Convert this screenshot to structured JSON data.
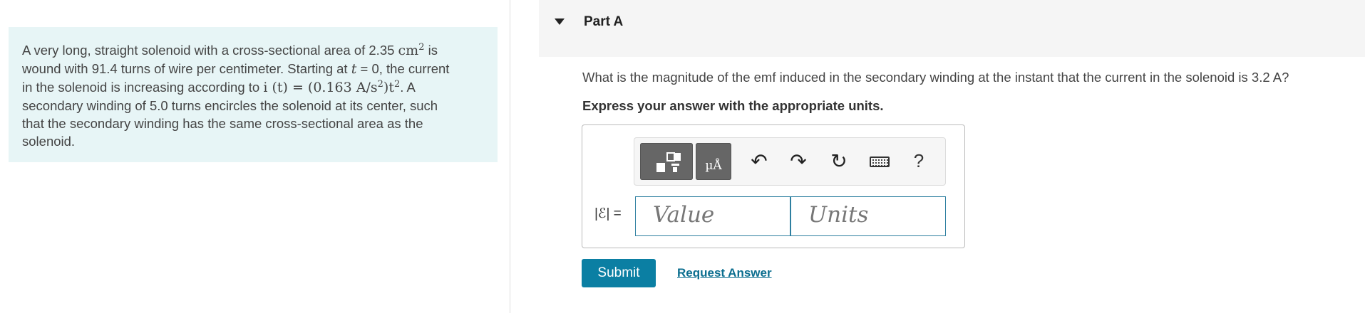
{
  "problem": {
    "line1_a": "A very long, straight solenoid with a cross-sectional area of 2.35 ",
    "line1_unit": "cm",
    "line1_exp": "2",
    "line1_b": " is",
    "line2_a": "wound with 91.4 turns of wire per centimeter. Starting at ",
    "line2_var": "t",
    "line2_b": " = 0, the current",
    "line3_a": "in the solenoid is increasing according to ",
    "line3_math1": "i (t) = (0.163 A/s",
    "line3_exp1": "2",
    "line3_math2": ")t",
    "line3_exp2": "2",
    "line3_b": ". A",
    "line4": "secondary winding of 5.0 turns encircles the solenoid at its center, such",
    "line5": "that the secondary winding has the same cross-sectional area as the",
    "line6": "solenoid."
  },
  "part": {
    "title": "Part A",
    "question": "What is the magnitude of the emf induced in the secondary winding at the instant that the current in the solenoid is 3.2 A?",
    "instruction": "Express your answer with the appropriate units."
  },
  "answer": {
    "label": "|ℰ| =",
    "value_placeholder": "Value",
    "units_placeholder": "Units"
  },
  "toolbar": {
    "undo_glyph": "↶",
    "redo_glyph": "↷",
    "reset_glyph": "↻",
    "help_glyph": "?",
    "unit_glyph": "µÅ",
    "icons": [
      "templates-icon",
      "units-icon",
      "undo-icon",
      "redo-icon",
      "reset-icon",
      "keyboard-icon",
      "help-icon"
    ]
  },
  "actions": {
    "submit": "Submit",
    "request_answer": "Request Answer"
  },
  "colors": {
    "problem_bg": "#e7f5f6",
    "accent": "#0b7fa3",
    "link": "#0b6e8f"
  }
}
